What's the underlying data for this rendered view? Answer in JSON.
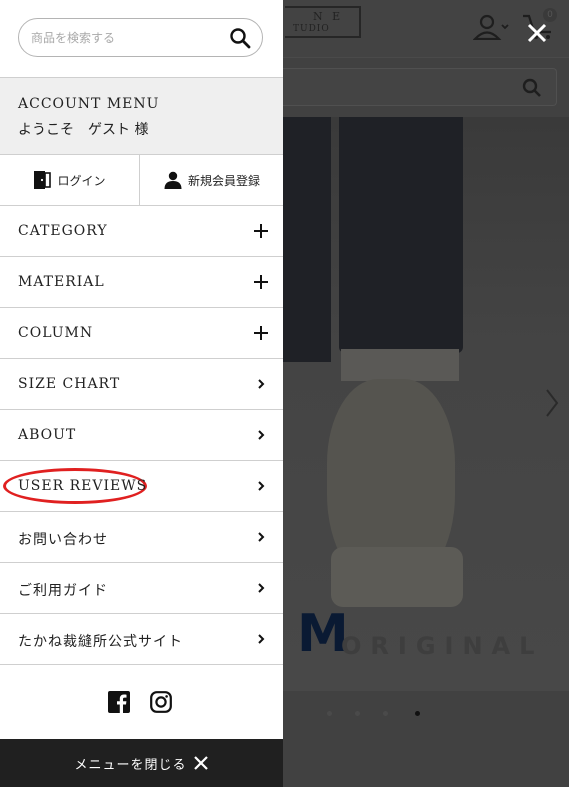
{
  "search": {
    "placeholder": "商品を検索する"
  },
  "account": {
    "title": "ACCOUNT MENU",
    "welcome": "ようこそ　ゲスト 様"
  },
  "auth": {
    "login_label": "ログイン",
    "register_label": "新規会員登録"
  },
  "menu": {
    "items": [
      {
        "label": "CATEGORY",
        "icon": "plus-icon"
      },
      {
        "label": "MATERIAL",
        "icon": "plus-icon"
      },
      {
        "label": "COLUMN",
        "icon": "plus-icon"
      },
      {
        "label": "SIZE CHART",
        "icon": "chevron-right-icon"
      },
      {
        "label": "ABOUT",
        "icon": "chevron-right-icon"
      },
      {
        "label": "USER REVIEWS",
        "icon": "chevron-right-icon",
        "highlighted": true
      },
      {
        "label": "お問い合わせ",
        "icon": "chevron-right-icon"
      },
      {
        "label": "ご利用ガイド",
        "icon": "chevron-right-icon"
      },
      {
        "label": "たかね裁縫所公式サイト",
        "icon": "chevron-right-icon"
      }
    ]
  },
  "social": {
    "icons": [
      "facebook-icon",
      "instagram-icon"
    ]
  },
  "close_menu": {
    "label": "メニューを閉じる"
  },
  "background": {
    "logo_line1": "N E",
    "logo_line2": "TUDIO",
    "cart_count": "0",
    "hero_text": "ORIGINAL",
    "hero_letter": "M"
  },
  "colors": {
    "highlight": "#e02020",
    "close_bar": "#202020",
    "account_bg": "#efefef"
  }
}
